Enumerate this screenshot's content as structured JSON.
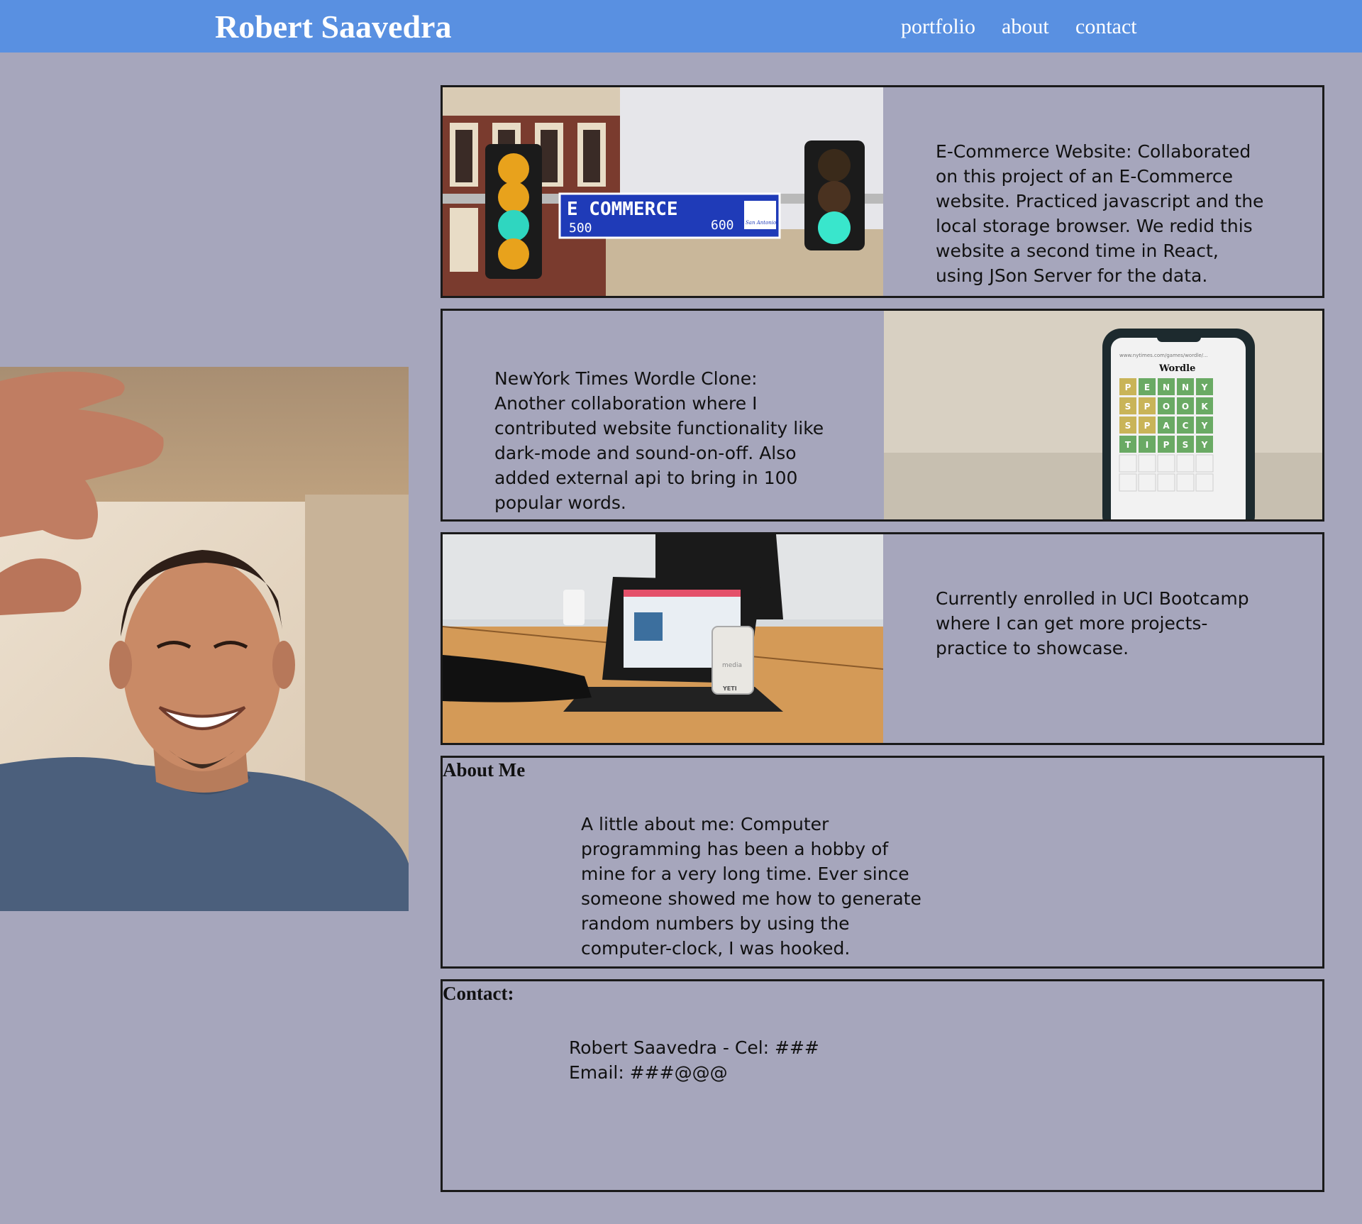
{
  "header": {
    "title": "Robert Saavedra",
    "nav": [
      "portfolio",
      "about",
      "contact"
    ]
  },
  "portfolio": [
    {
      "description": "E-Commerce Website: Collaborated on this project of an E-Commerce website. Practiced javascript and the local storage browser. We redid this website a second time in React, using JSon Server for the data.",
      "image": {
        "sign_main": "E COMMERCE",
        "sign_left_num": "500",
        "sign_right_num": "600",
        "sign_badge": "San Antonio"
      }
    },
    {
      "description": "NewYork Times Wordle Clone: Another collaboration where I contributed website functionality like dark-mode and sound-on-off. Also added external api to bring in 100 popular words.",
      "image": {
        "app_title": "Wordle",
        "url": "www.nytimes.com/games/wordle/...",
        "rows": [
          "PENNY",
          "SPOOK",
          "SPACY",
          "TIPSY"
        ]
      }
    },
    {
      "description": "Currently enrolled in UCI Bootcamp where I can get more projects-practice to showcase.",
      "image": {
        "cup_brand": "YETI",
        "cup_label": "media"
      }
    }
  ],
  "about": {
    "heading": "About Me",
    "text": "A little about me: Computer programming has been a hobby of mine for a very long time. Ever since someone showed me how to generate random numbers by using the computer-clock, I was hooked."
  },
  "contact": {
    "heading": "Contact:",
    "text": "Robert Saavedra - Cel: ### Email: ###@@@"
  }
}
